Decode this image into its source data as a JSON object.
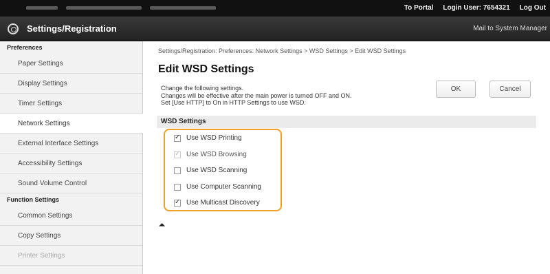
{
  "topbar": {
    "portal_link": "To Portal",
    "login_user": "Login User:  7654321",
    "logout": "Log Out"
  },
  "header": {
    "title": "Settings/Registration",
    "mail_link": "Mail to System Manager"
  },
  "sidebar": {
    "sections": [
      {
        "heading": "Preferences",
        "items": [
          {
            "label": "Paper Settings"
          },
          {
            "label": "Display Settings"
          },
          {
            "label": "Timer Settings"
          },
          {
            "label": "Network Settings"
          },
          {
            "label": "External Interface Settings"
          },
          {
            "label": "Accessibility Settings"
          },
          {
            "label": "Sound Volume Control"
          }
        ]
      },
      {
        "heading": "Function Settings",
        "items": [
          {
            "label": "Common Settings"
          },
          {
            "label": "Copy Settings"
          },
          {
            "label": "Printer Settings"
          }
        ]
      }
    ],
    "active_item": "Network Settings"
  },
  "main": {
    "breadcrumb": "Settings/Registration: Preferences: Network Settings > WSD Settings > Edit WSD Settings",
    "page_title": "Edit WSD Settings",
    "description_lines": [
      "Change the following settings.",
      "Changes will be effective after the main power is turned OFF and ON.",
      "Set [Use HTTP] to On in HTTP Settings to use WSD."
    ],
    "ok_label": "OK",
    "cancel_label": "Cancel",
    "section_title": "WSD Settings",
    "options": [
      {
        "label": "Use WSD Printing",
        "checked": true,
        "enabled": true
      },
      {
        "label": "Use WSD Browsing",
        "checked": true,
        "enabled": false
      },
      {
        "label": "Use WSD Scanning",
        "checked": false,
        "enabled": true
      },
      {
        "label": "Use Computer Scanning",
        "checked": false,
        "enabled": true
      },
      {
        "label": "Use Multicast Discovery",
        "checked": true,
        "enabled": true
      }
    ],
    "to_top_glyph": "⏶"
  },
  "colors": {
    "highlight_border": "#f0a024",
    "header_bg": "#222222"
  }
}
